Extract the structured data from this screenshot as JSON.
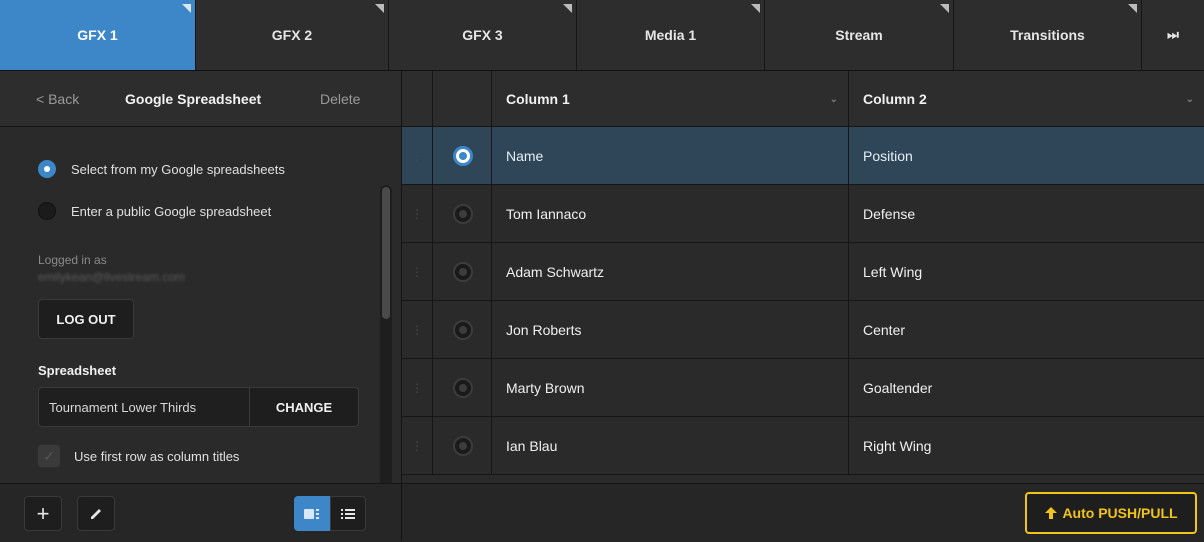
{
  "tabs": [
    {
      "label": "GFX 1",
      "active": true
    },
    {
      "label": "GFX 2",
      "active": false
    },
    {
      "label": "GFX 3",
      "active": false
    },
    {
      "label": "Media 1",
      "active": false
    },
    {
      "label": "Stream",
      "active": false
    },
    {
      "label": "Transitions",
      "active": false
    }
  ],
  "tab_overflow_icon": "⏭",
  "left": {
    "back_label": "< Back",
    "title": "Google Spreadsheet",
    "delete_label": "Delete",
    "radio_options": [
      {
        "label": "Select from my Google spreadsheets",
        "selected": true
      },
      {
        "label": "Enter a public Google spreadsheet",
        "selected": false
      }
    ],
    "logged_in_label": "Logged in as",
    "logged_in_email": "emilykean@livestream.com",
    "logout_label": "LOG OUT",
    "spreadsheet_label": "Spreadsheet",
    "spreadsheet_value": "Tournament Lower Thirds",
    "change_label": "CHANGE",
    "first_row_label": "Use first row as column titles",
    "footer": {
      "add_icon": "+",
      "edit_icon": "pencil-icon",
      "view_grid_icon": "grid-icon",
      "view_list_icon": "list-icon"
    }
  },
  "table": {
    "columns": [
      "Column 1",
      "Column 2"
    ],
    "rows": [
      {
        "c1": "Name",
        "c2": "Position",
        "selected": true
      },
      {
        "c1": "Tom Iannaco",
        "c2": "Defense",
        "selected": false
      },
      {
        "c1": "Adam Schwartz",
        "c2": "Left Wing",
        "selected": false
      },
      {
        "c1": "Jon Roberts",
        "c2": "Center",
        "selected": false
      },
      {
        "c1": "Marty Brown",
        "c2": "Goaltender",
        "selected": false
      },
      {
        "c1": "Ian Blau",
        "c2": "Right Wing",
        "selected": false
      }
    ]
  },
  "push_button_label": "Auto PUSH/PULL",
  "colors": {
    "accent": "#3d87c8",
    "push_accent": "#f0c419",
    "selected_row": "#2f4558"
  }
}
